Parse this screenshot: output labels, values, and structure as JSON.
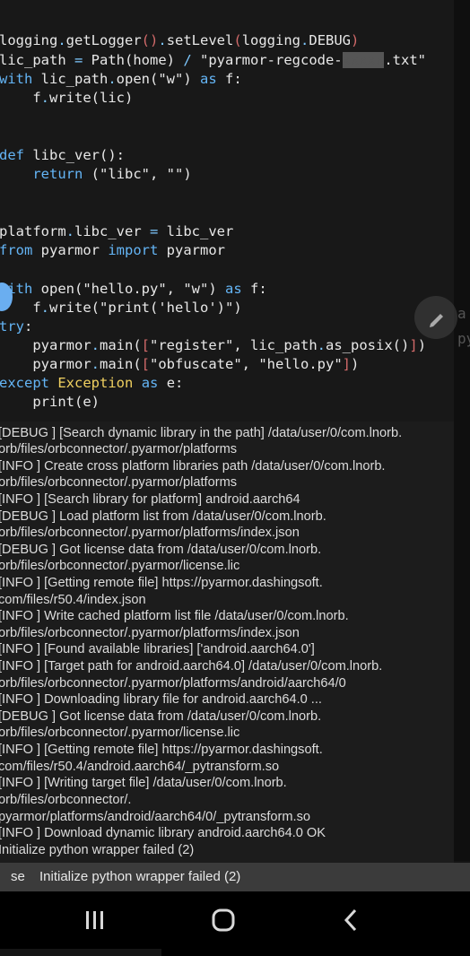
{
  "code": {
    "lines": [
      "logging.getLogger().setLevel(logging.DEBUG)",
      "lic_path = Path(home) / \"pyarmor-regcode-     .txt\"",
      "with lic_path.open(\"w\") as f:",
      "    f.write(lic)",
      "def libc_ver():",
      "    return (\"libc\", \"\")",
      "platform.libc_ver = libc_ver",
      "from pyarmor import pyarmor",
      "with open(\"hello.py\", \"w\") as f:",
      "    f.write(\"print('hello')\")",
      "try:",
      "    pyarmor.main([\"register\", lic_path.as_posix()])",
      "    pyarmor.main([\"obfuscate\", \"hello.py\"])",
      "except Exception as e:",
      "    print(e)"
    ]
  },
  "ghost": [
    "a",
    "py"
  ],
  "console": {
    "lines": [
      "[DEBUG ] [Search dynamic library in the path] /data/user/0/com.lnorb.",
      "orb/files/orbconnector/.pyarmor/platforms",
      "[INFO  ] Create cross platform libraries path /data/user/0/com.lnorb.",
      "orb/files/orbconnector/.pyarmor/platforms",
      "[INFO  ] [Search library for platform] android.aarch64",
      "[DEBUG ] Load platform list from /data/user/0/com.lnorb.",
      "orb/files/orbconnector/.pyarmor/platforms/index.json",
      "[DEBUG ] Got license data from /data/user/0/com.lnorb.",
      "orb/files/orbconnector/.pyarmor/license.lic",
      "[INFO  ] [Getting remote file] https://pyarmor.dashingsoft.",
      "com/files/r50.4/index.json",
      "[INFO  ] Write cached platform list file /data/user/0/com.lnorb.",
      "orb/files/orbconnector/.pyarmor/platforms/index.json",
      "[INFO  ] [Found available libraries] ['android.aarch64.0']",
      "[INFO  ] [Target path for android.aarch64.0] /data/user/0/com.lnorb.",
      "orb/files/orbconnector/.pyarmor/platforms/android/aarch64/0",
      "[INFO  ] Downloading library file for android.aarch64.0 ...",
      "[DEBUG ] Got license data from /data/user/0/com.lnorb.",
      "orb/files/orbconnector/.pyarmor/license.lic",
      "[INFO  ] [Getting remote file] https://pyarmor.dashingsoft.",
      "com/files/r50.4/android.aarch64/_pytransform.so",
      "[INFO  ] [Writing target file] /data/user/0/com.lnorb.",
      "orb/files/orbconnector/.",
      "pyarmor/platforms/android/aarch64/0/_pytransform.so",
      "[INFO  ] Download dynamic library android.aarch64.0 OK",
      "Initialize python wrapper failed (2)"
    ]
  },
  "status": {
    "tag": "se",
    "message": "Initialize python wrapper failed (2)"
  },
  "nav": {
    "recents": "recent-apps-icon",
    "home": "home-icon",
    "back": "back-icon"
  }
}
